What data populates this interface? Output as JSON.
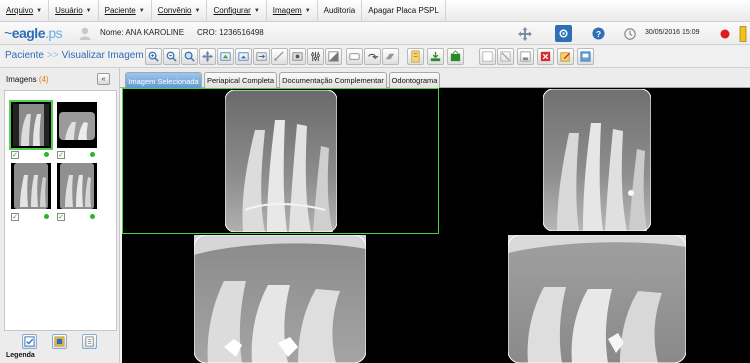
{
  "menu": {
    "items": [
      {
        "label": "Arquivo",
        "caret": true
      },
      {
        "label": "Usuário",
        "caret": true
      },
      {
        "label": "Paciente",
        "caret": true
      },
      {
        "label": "Convênio",
        "caret": true
      },
      {
        "label": "Configurar",
        "caret": true
      },
      {
        "label": "Imagem",
        "caret": true
      },
      {
        "label": "Auditoria",
        "caret": false
      },
      {
        "label": "Apagar Placa PSPL",
        "caret": false
      }
    ]
  },
  "header": {
    "logo_main": "eagle",
    "logo_suffix": ".ps",
    "patient_name": "Nome: ANA KAROLINE",
    "cro": "CRO: 1236516498",
    "datetime": "30/05/2016 15:09"
  },
  "toolbar": {
    "breadcrumb_parent": "Paciente",
    "breadcrumb_sep": ">>",
    "breadcrumb_current": "Visualizar Imagem"
  },
  "sidebar": {
    "title": "Imagens",
    "count": "(4)",
    "collapse_label": "«",
    "legend_label": "Legenda"
  },
  "tabs": [
    {
      "label": "Imagem Selecionada",
      "active": true
    },
    {
      "label": "Periapical Completa",
      "active": false
    },
    {
      "label": "Documentação Complementar",
      "active": false
    },
    {
      "label": "Odontograma",
      "active": false
    }
  ],
  "colors": {
    "accent_blue": "#2e6eb5",
    "selection_green": "#43d640",
    "status_green": "#2bb52b",
    "record_red": "#e01c1c",
    "count_orange": "#e07b00"
  },
  "icons": {
    "toolbar": [
      "zoom-in-icon",
      "zoom-out-icon",
      "zoom-fit-icon",
      "pan-icon",
      "rotate-left-icon",
      "rotate-right-icon",
      "flip-icon",
      "measure-icon",
      "brightness-icon",
      "contrast-icon",
      "invert-icon",
      "undo-icon",
      "eraser-icon",
      "notes-icon",
      "export-icon",
      "import-icon",
      "select-icon",
      "pointer-icon",
      "save-icon",
      "delete-icon",
      "edit-icon",
      "copy-icon",
      "print-icon"
    ],
    "header": [
      "move-icon",
      "settings-icon",
      "help-icon",
      "clock-icon",
      "record-icon",
      "exit-icon"
    ]
  }
}
